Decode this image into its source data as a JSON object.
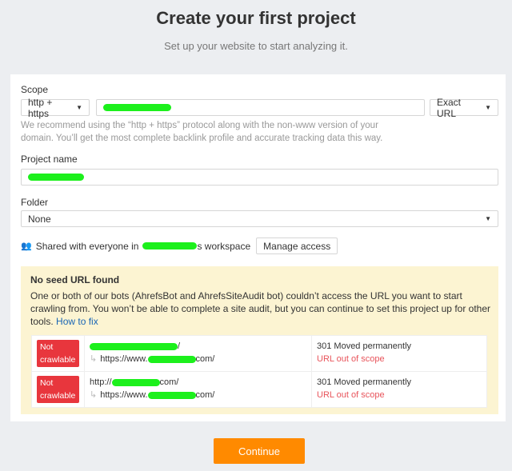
{
  "header": {
    "title": "Create your first project",
    "subtitle": "Set up your website to start analyzing it."
  },
  "form": {
    "scope_label": "Scope",
    "protocol": "http + https",
    "url_value": "",
    "mode": "Exact URL",
    "hint": "We recommend using the “http + https” protocol along with the non-www version of your domain. You’ll get the most complete backlink profile and accurate tracking data this way.",
    "project_name_label": "Project name",
    "folder_label": "Folder",
    "folder_value": "None",
    "shared_prefix": "Shared with everyone in",
    "shared_suffix": "s workspace",
    "manage_access": "Manage access"
  },
  "warning": {
    "title": "No seed URL found",
    "body": "One or both of our bots (AhrefsBot and AhrefsSiteAudit bot) couldn’t access the URL you want to start crawling from. You won’t be able to complete a site audit, but you can continue to set this project up for other tools.",
    "link": "How to fix",
    "rows": [
      {
        "badge": "Not crawlable",
        "url_prefix": "",
        "url_suffix": "/",
        "redirect_prefix": "https://www.",
        "redirect_suffix": "com/",
        "status": "301 Moved permanently",
        "scope": "URL out of scope"
      },
      {
        "badge": "Not crawlable",
        "url_prefix": "http://",
        "url_suffix": "com/",
        "redirect_prefix": "https://www.",
        "redirect_suffix": "com/",
        "status": "301 Moved permanently",
        "scope": "URL out of scope"
      }
    ]
  },
  "footer": {
    "continue": "Continue"
  },
  "colors": {
    "accent": "#ff8a00",
    "danger": "#e8363d",
    "warning_bg": "#fcf4d2",
    "redaction": "#1cf01c"
  }
}
